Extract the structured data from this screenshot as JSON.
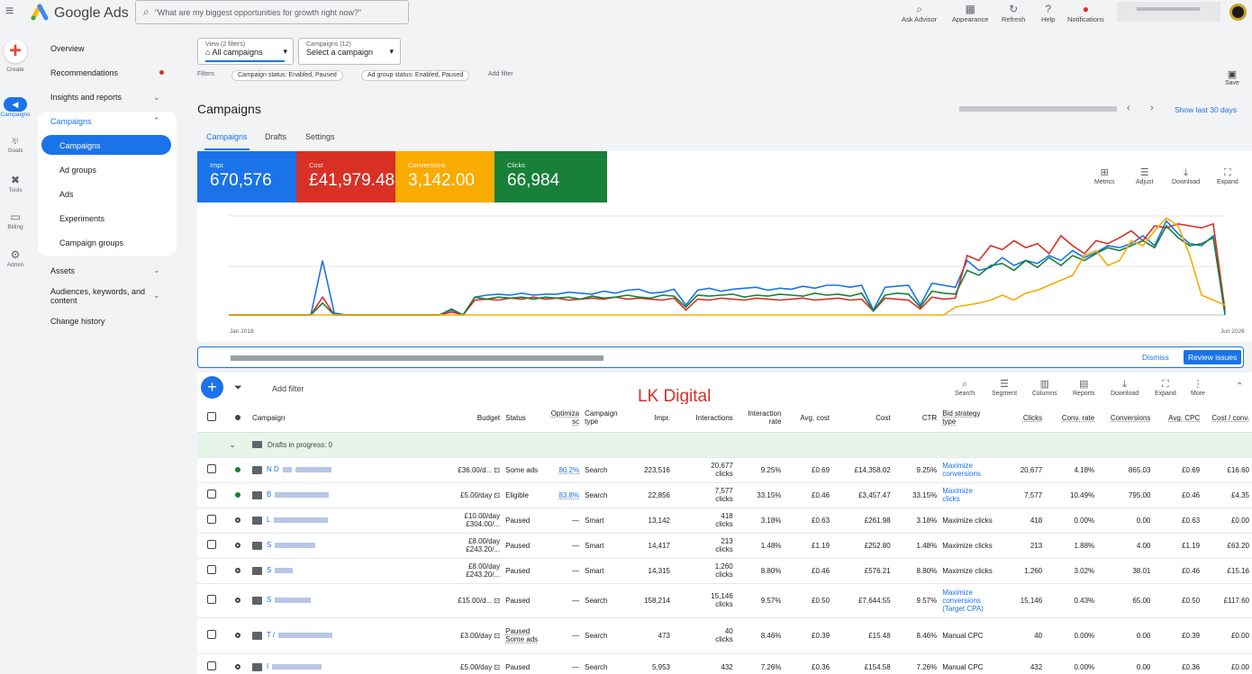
{
  "app": {
    "brand": "Google Ads",
    "search_placeholder": "\"What are my biggest opportunities for growth right now?\""
  },
  "toolbar": [
    {
      "label": "Ask Advisor",
      "icon": "search-sparkle-icon"
    },
    {
      "label": "Appearance",
      "icon": "appearance-icon"
    },
    {
      "label": "Refresh",
      "icon": "refresh-icon"
    },
    {
      "label": "Help",
      "icon": "help-icon"
    },
    {
      "label": "Notifications",
      "icon": "bell-icon"
    }
  ],
  "rail": [
    {
      "label": "Create",
      "icon": "plus-icon"
    },
    {
      "label": "Campaigns",
      "icon": "megaphone-icon"
    },
    {
      "label": "Goals",
      "icon": "trophy-icon"
    },
    {
      "label": "Tools",
      "icon": "tools-icon"
    },
    {
      "label": "Billing",
      "icon": "card-icon"
    },
    {
      "label": "Admin",
      "icon": "gear-icon"
    }
  ],
  "nav": {
    "overview": "Overview",
    "recommendations": "Recommendations",
    "insights": "Insights and reports",
    "campaigns_group": "Campaigns",
    "campaigns": "Campaigns",
    "ad_groups": "Ad groups",
    "ads": "Ads",
    "experiments": "Experiments",
    "campaign_groups": "Campaign groups",
    "assets": "Assets",
    "audiences_1": "Audiences, keywords, and",
    "audiences_2": "content",
    "change_history": "Change history"
  },
  "filters": {
    "view_label": "View (2 filters)",
    "view_value": "All campaigns",
    "campaigns_label": "Campaigns (12)",
    "campaigns_value": "Select a campaign",
    "filters_label": "Filters",
    "chip1": "Campaign status: Enabled, Paused",
    "chip2": "Ad group status: Enabled, Paused",
    "add_filter": "Add filter",
    "save": "Save"
  },
  "page": {
    "title": "Campaigns",
    "show_last": "Show last 30 days",
    "tabs": [
      "Campaigns",
      "Drafts",
      "Settings"
    ]
  },
  "metrics": [
    {
      "label": "Impr.",
      "value": "670,576",
      "color": "#1a73e8"
    },
    {
      "label": "Cost",
      "value": "£41,979.48",
      "color": "#d93025"
    },
    {
      "label": "Conversions",
      "value": "3,142.00",
      "color": "#f9ab00"
    },
    {
      "label": "Clicks",
      "value": "66,984",
      "color": "#188038"
    }
  ],
  "chart_tools": [
    "Metrics",
    "Adjust",
    "Download",
    "Expand"
  ],
  "chart_data": {
    "type": "line",
    "x_start": "Jan 2018",
    "x_end": "Jun 2026",
    "y_range": [
      0,
      1
    ],
    "series": [
      {
        "color": "#1a73e8",
        "values": [
          0,
          0,
          0,
          0,
          0,
          0,
          0,
          0,
          0.55,
          0.02,
          0,
          0,
          0,
          0,
          0,
          0,
          0,
          0,
          0,
          0.05,
          0,
          0.18,
          0.2,
          0.21,
          0.2,
          0.22,
          0.2,
          0.21,
          0.21,
          0.23,
          0.22,
          0.21,
          0.24,
          0.22,
          0.25,
          0.26,
          0.22,
          0.23,
          0.26,
          0.1,
          0.25,
          0.27,
          0.24,
          0.26,
          0.27,
          0.28,
          0.25,
          0.27,
          0.26,
          0.29,
          0.27,
          0.3,
          0.3,
          0.28,
          0.3,
          0.05,
          0.28,
          0.29,
          0.3,
          0.1,
          0.32,
          0.3,
          0.28,
          0.55,
          0.45,
          0.48,
          0.58,
          0.5,
          0.55,
          0.52,
          0.6,
          0.55,
          0.65,
          0.58,
          0.63,
          0.7,
          0.68,
          0.72,
          0.8,
          0.7,
          0.95,
          0.82,
          0.72,
          0.7,
          0.8,
          0
        ]
      },
      {
        "color": "#d93025",
        "values": [
          0,
          0,
          0,
          0,
          0,
          0,
          0,
          0,
          0.18,
          0,
          0,
          0,
          0,
          0,
          0,
          0,
          0,
          0,
          0,
          0.03,
          0,
          0.15,
          0.16,
          0.15,
          0.17,
          0.16,
          0.18,
          0.16,
          0.17,
          0.15,
          0.16,
          0.17,
          0.16,
          0.18,
          0.16,
          0.17,
          0.16,
          0.15,
          0.17,
          0.05,
          0.16,
          0.15,
          0.17,
          0.16,
          0.15,
          0.17,
          0.16,
          0.15,
          0.16,
          0.17,
          0.15,
          0.16,
          0.17,
          0.15,
          0.16,
          0.04,
          0.17,
          0.16,
          0.15,
          0.06,
          0.18,
          0.16,
          0.17,
          0.6,
          0.55,
          0.7,
          0.66,
          0.75,
          0.68,
          0.72,
          0.62,
          0.8,
          0.7,
          0.62,
          0.75,
          0.72,
          0.78,
          0.85,
          0.75,
          0.9,
          0.88,
          0.92,
          0.9,
          0.88,
          0.92,
          0.05
        ]
      },
      {
        "color": "#188038",
        "values": [
          0,
          0,
          0,
          0,
          0,
          0,
          0,
          0,
          0.12,
          0,
          0,
          0,
          0,
          0,
          0,
          0,
          0,
          0,
          0,
          0.06,
          0,
          0.18,
          0.16,
          0.18,
          0.17,
          0.18,
          0.16,
          0.18,
          0.17,
          0.18,
          0.16,
          0.19,
          0.17,
          0.18,
          0.2,
          0.18,
          0.17,
          0.2,
          0.19,
          0.08,
          0.2,
          0.19,
          0.2,
          0.21,
          0.18,
          0.2,
          0.19,
          0.21,
          0.2,
          0.19,
          0.22,
          0.2,
          0.21,
          0.19,
          0.22,
          0.04,
          0.2,
          0.22,
          0.21,
          0.08,
          0.24,
          0.22,
          0.21,
          0.45,
          0.4,
          0.5,
          0.52,
          0.45,
          0.55,
          0.48,
          0.58,
          0.5,
          0.6,
          0.55,
          0.62,
          0.68,
          0.65,
          0.7,
          0.75,
          0.68,
          0.9,
          0.78,
          0.7,
          0.72,
          0.78,
          0.02
        ]
      },
      {
        "color": "#f9ab00",
        "values": [
          0,
          0,
          0,
          0,
          0,
          0,
          0,
          0,
          0,
          0,
          0,
          0,
          0,
          0,
          0,
          0,
          0,
          0,
          0,
          0,
          0,
          0,
          0,
          0,
          0,
          0,
          0,
          0,
          0,
          0,
          0,
          0,
          0,
          0,
          0,
          0,
          0,
          0,
          0,
          0,
          0,
          0,
          0,
          0,
          0,
          0,
          0,
          0,
          0,
          0,
          0,
          0,
          0,
          0,
          0,
          0,
          0,
          0,
          0,
          0,
          0,
          0,
          0.08,
          0.1,
          0.12,
          0.15,
          0.2,
          0.15,
          0.22,
          0.25,
          0.3,
          0.35,
          0.4,
          0.6,
          0.65,
          0.5,
          0.55,
          0.75,
          0.7,
          0.85,
          0.98,
          0.9,
          0.6,
          0.2,
          0.15,
          0.1
        ]
      }
    ]
  },
  "banner": {
    "dismiss": "Dismiss",
    "review": "Review issues"
  },
  "table_tools": {
    "add_filter": "Add filter",
    "items": [
      "Search",
      "Segment",
      "Columns",
      "Reports",
      "Download",
      "Expand",
      "More"
    ]
  },
  "watermark": "LK Digital",
  "table": {
    "headers": {
      "campaign": "Campaign",
      "budget": "Budget",
      "status": "Status",
      "optimiza_1": "Optimiza",
      "optimiza_2": "sc",
      "type_1": "Campaign",
      "type_2": "type",
      "impr": "Impr.",
      "interactions": "Interactions",
      "irate_1": "Interaction",
      "irate_2": "rate",
      "avgcost": "Avg. cost",
      "cost": "Cost",
      "ctr": "CTR",
      "bid_1": "Bid strategy",
      "bid_2": "type",
      "clicks": "Clicks",
      "convrate": "Conv. rate",
      "conversions": "Conversions",
      "avgcpc": "Avg. CPC",
      "costconv": "Cost / conv."
    },
    "draft_label": "Drafts in progress: 0",
    "rows": [
      {
        "prefix": "N D",
        "budget1": "£36.00/d...",
        "budget2": "",
        "status1": "Some ads",
        "status2": "",
        "opt": "80.2%",
        "type": "Search",
        "impr": "223,516",
        "inter1": "20,677",
        "inter2": "clicks",
        "irate": "9.25%",
        "avgcost": "£0.69",
        "cost": "£14,358.02",
        "ctr": "9.25%",
        "bid1": "Maximize",
        "bid2": "conversions",
        "bid3": "",
        "clicks": "20,677",
        "convrate": "4.18%",
        "conv": "865.03",
        "cpc": "£0.69",
        "costconv": "£16.60"
      },
      {
        "prefix": "B",
        "budget1": "£5.00/day",
        "budget2": "",
        "status1": "Eligible",
        "status2": "",
        "opt": "83.8%",
        "type": "Search",
        "impr": "22,856",
        "inter1": "7,577",
        "inter2": "clicks",
        "irate": "33.15%",
        "avgcost": "£0.46",
        "cost": "£3,457.47",
        "ctr": "33.15%",
        "bid1": "Maximize",
        "bid2": "clicks",
        "bid3": "",
        "clicks": "7,577",
        "convrate": "10.49%",
        "conv": "795.00",
        "cpc": "£0.46",
        "costconv": "£4.35"
      },
      {
        "prefix": "L",
        "budget1": "£10.00/day",
        "budget2": "£304.00/...",
        "status1": "Paused",
        "status2": "",
        "opt": "—",
        "type": "Smart",
        "impr": "13,142",
        "inter1": "418",
        "inter2": "clicks",
        "irate": "3.18%",
        "avgcost": "£0.63",
        "cost": "£261.98",
        "ctr": "3.18%",
        "bid1": "Maximize clicks",
        "bid2": "",
        "bid3": "",
        "clicks": "418",
        "convrate": "0.00%",
        "conv": "0.00",
        "cpc": "£0.63",
        "costconv": "£0.00"
      },
      {
        "prefix": "S",
        "budget1": "£8.00/day",
        "budget2": "£243.20/...",
        "status1": "Paused",
        "status2": "",
        "opt": "—",
        "type": "Smart",
        "impr": "14,417",
        "inter1": "213",
        "inter2": "clicks",
        "irate": "1.48%",
        "avgcost": "£1.19",
        "cost": "£252.80",
        "ctr": "1.48%",
        "bid1": "Maximize clicks",
        "bid2": "",
        "bid3": "",
        "clicks": "213",
        "convrate": "1.88%",
        "conv": "4.00",
        "cpc": "£1.19",
        "costconv": "£63.20"
      },
      {
        "prefix": "S",
        "budget1": "£8.00/day",
        "budget2": "£243.20/...",
        "status1": "Paused",
        "status2": "",
        "opt": "—",
        "type": "Smart",
        "impr": "14,315",
        "inter1": "1,260",
        "inter2": "clicks",
        "irate": "8.80%",
        "avgcost": "£0.46",
        "cost": "£576.21",
        "ctr": "8.80%",
        "bid1": "Maximize clicks",
        "bid2": "",
        "bid3": "",
        "clicks": "1,260",
        "convrate": "3.02%",
        "conv": "38.01",
        "cpc": "£0.46",
        "costconv": "£15.16"
      },
      {
        "prefix": "S",
        "budget1": "£15.00/d...",
        "budget2": "",
        "status1": "Paused",
        "status2": "",
        "opt": "—",
        "type": "Search",
        "impr": "158,214",
        "inter1": "15,146",
        "inter2": "clicks",
        "irate": "9.57%",
        "avgcost": "£0.50",
        "cost": "£7,644.55",
        "ctr": "9.57%",
        "bid1": "Maximize",
        "bid2": "conversions",
        "bid3": "(Target CPA)",
        "clicks": "15,146",
        "convrate": "0.43%",
        "conv": "65.00",
        "cpc": "£0.50",
        "costconv": "£117.60"
      },
      {
        "prefix": "T /",
        "budget1": "£3.00/day",
        "budget2": "",
        "status1": "Paused",
        "status2": "Some ads",
        "opt": "—",
        "type": "Search",
        "impr": "473",
        "inter1": "40",
        "inter2": "clicks",
        "irate": "8.46%",
        "avgcost": "£0.39",
        "cost": "£15.48",
        "ctr": "8.46%",
        "bid1": "Manual CPC",
        "bid2": "",
        "bid3": "",
        "clicks": "40",
        "convrate": "0.00%",
        "conv": "0.00",
        "cpc": "£0.39",
        "costconv": "£0.00"
      },
      {
        "prefix": "I",
        "budget1": "£5.00/day",
        "budget2": "",
        "status1": "Paused",
        "status2": "",
        "opt": "—",
        "type": "Search",
        "impr": "5,953",
        "inter1": "432",
        "inter2": "",
        "irate": "7.26%",
        "avgcost": "£0.36",
        "cost": "£154.58",
        "ctr": "7.26%",
        "bid1": "Manual CPC",
        "bid2": "",
        "bid3": "",
        "clicks": "432",
        "convrate": "0.00%",
        "conv": "0.00",
        "cpc": "£0.36",
        "costconv": "£0.00"
      }
    ]
  }
}
